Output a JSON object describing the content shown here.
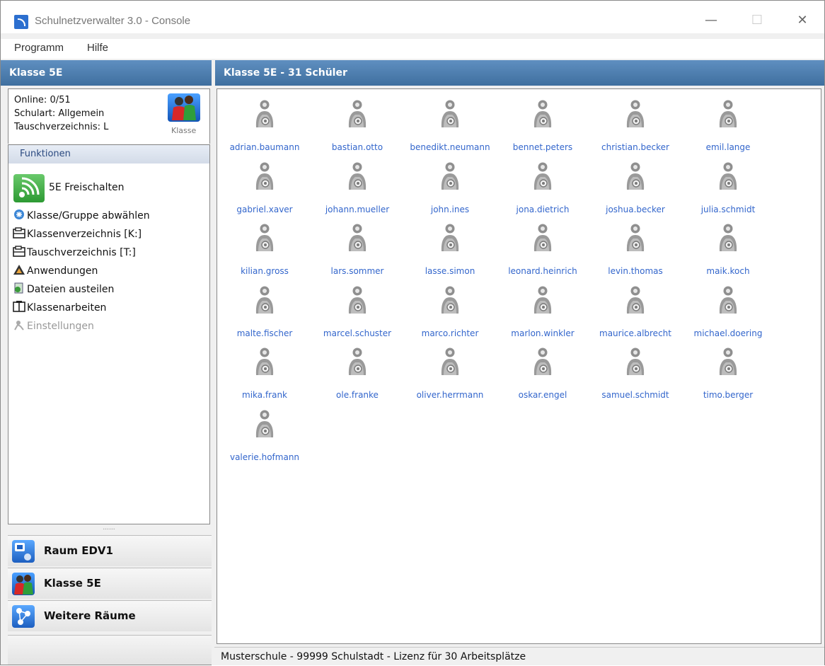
{
  "window": {
    "title": "Schulnetzverwalter 3.0 - Console",
    "minimize": "—",
    "maximize": "☐",
    "close": "✕"
  },
  "menu": [
    "Programm",
    "Hilfe"
  ],
  "left_panel": {
    "header": "Klasse 5E",
    "online": "Online: 0/51",
    "schulart": "Schulart: Allgemein",
    "tauschverzeichnis": "Tauschverzeichnis: L",
    "klasse_caption": "Klasse",
    "functions_header": "Funktionen",
    "freischalten": "5E Freischalten",
    "functions": [
      {
        "label": "Klasse/Gruppe abwählen",
        "icon": "deselect-icon"
      },
      {
        "label": "Klassenverzeichnis [K:]",
        "icon": "folder-drive-icon"
      },
      {
        "label": "Tauschverzeichnis [T:]",
        "icon": "folder-drive-icon"
      },
      {
        "label": "Anwendungen",
        "icon": "applications-icon"
      },
      {
        "label": "Dateien austeilen",
        "icon": "distribute-files-icon"
      },
      {
        "label": "Klassenarbeiten",
        "icon": "exam-icon"
      },
      {
        "label": "Einstellungen",
        "icon": "settings-icon"
      }
    ],
    "splitter": "......",
    "nav": [
      {
        "label": "Raum EDV1",
        "icon": "room-icon"
      },
      {
        "label": "Klasse 5E",
        "icon": "class-icon"
      },
      {
        "label": "Weitere Räume",
        "icon": "network-icon"
      }
    ]
  },
  "main": {
    "header": "Klasse 5E - 31 Schüler",
    "students": [
      "adrian.baumann",
      "bastian.otto",
      "benedikt.neumann",
      "bennet.peters",
      "christian.becker",
      "emil.lange",
      "gabriel.xaver",
      "johann.mueller",
      "john.ines",
      "jona.dietrich",
      "joshua.becker",
      "julia.schmidt",
      "kilian.gross",
      "lars.sommer",
      "lasse.simon",
      "leonard.heinrich",
      "levin.thomas",
      "maik.koch",
      "malte.fischer",
      "marcel.schuster",
      "marco.richter",
      "marlon.winkler",
      "maurice.albrecht",
      "michael.doering",
      "mika.frank",
      "ole.franke",
      "oliver.herrmann",
      "oskar.engel",
      "samuel.schmidt",
      "timo.berger",
      "valerie.hofmann"
    ]
  },
  "status": "Musterschule - 99999 Schulstadt - Lizenz für 30 Arbeitsplätze",
  "colors": {
    "header_blue": "#4f7fb0",
    "link_blue": "#3366cc",
    "icon_gray": "#8a8a8a"
  }
}
